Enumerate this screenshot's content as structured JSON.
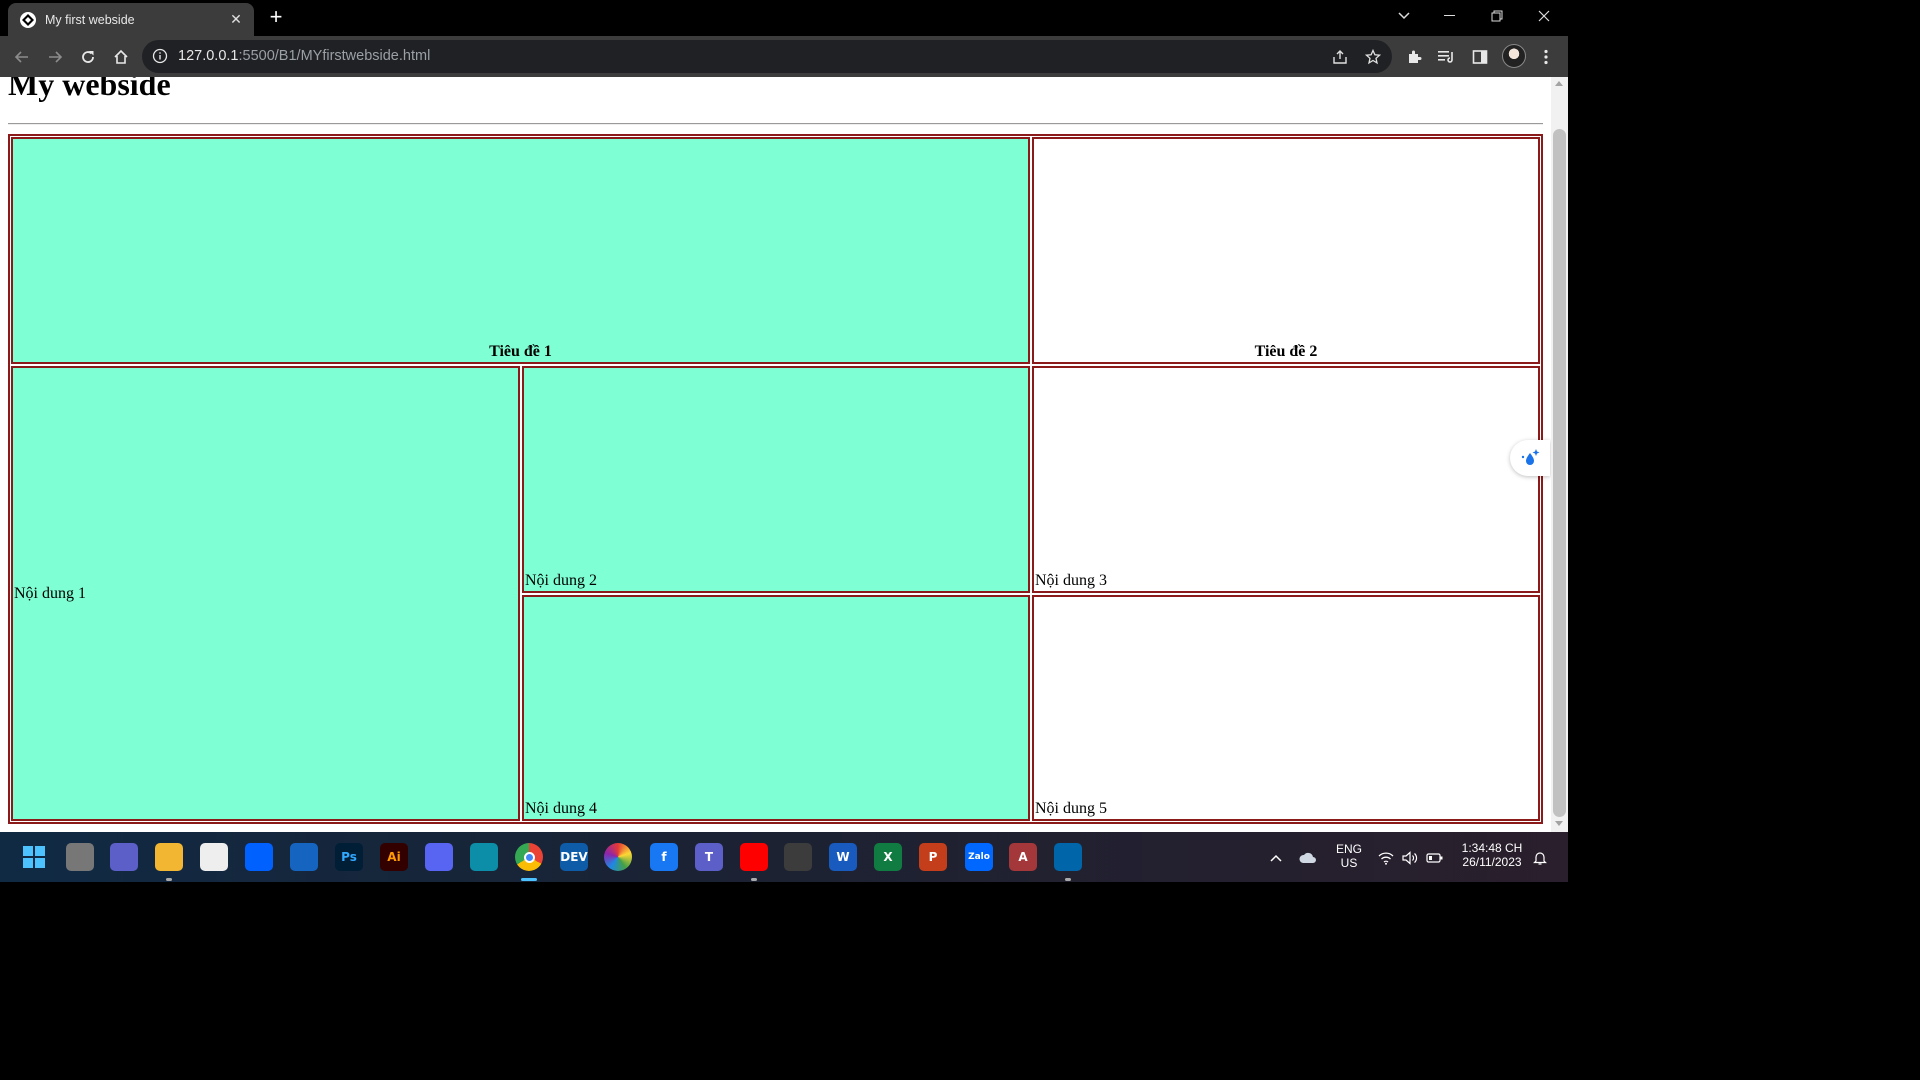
{
  "browser": {
    "tab_title": "My first webside",
    "tab_close": "✕",
    "new_tab": "+",
    "url_host": "127.0.0.1",
    "url_path": ":5500/B1/MYfirstwebside.html"
  },
  "page": {
    "heading": "My webside",
    "table": {
      "header1": "Tiêu đề 1",
      "header2": "Tiêu đề 2",
      "content1": "Nội dung 1",
      "content2": "Nội dung 2",
      "content3": "Nội dung 3",
      "content4": "Nội dung 4",
      "content5": "Nội dung 5"
    },
    "colors": {
      "aqua": "#7fffd4",
      "border": "#8b1a1a"
    }
  },
  "taskbar": {
    "apps": [
      {
        "name": "start",
        "icon": "windows-icon"
      },
      {
        "name": "task-view",
        "icon": "task-view-icon"
      },
      {
        "name": "meet",
        "icon": "video-icon"
      },
      {
        "name": "file-explorer",
        "icon": "folder-icon"
      },
      {
        "name": "store",
        "icon": "store-icon"
      },
      {
        "name": "dropbox",
        "icon": "dropbox-icon"
      },
      {
        "name": "defender",
        "icon": "shield-icon"
      },
      {
        "name": "photoshop",
        "icon": "ps-icon",
        "label": "Ps"
      },
      {
        "name": "illustrator",
        "icon": "ai-icon",
        "label": "Ai"
      },
      {
        "name": "discord",
        "icon": "discord-icon"
      },
      {
        "name": "edge",
        "icon": "edge-icon"
      },
      {
        "name": "chrome",
        "icon": "chrome-icon"
      },
      {
        "name": "devc",
        "icon": "devc-icon",
        "label": "DEV"
      },
      {
        "name": "color",
        "icon": "color-wheel-icon"
      },
      {
        "name": "facebook",
        "icon": "facebook-icon",
        "label": "f"
      },
      {
        "name": "teams",
        "icon": "teams-icon",
        "label": "T"
      },
      {
        "name": "youtube",
        "icon": "youtube-icon"
      },
      {
        "name": "git",
        "icon": "git-icon"
      },
      {
        "name": "word",
        "icon": "word-icon",
        "label": "W"
      },
      {
        "name": "excel",
        "icon": "excel-icon",
        "label": "X"
      },
      {
        "name": "powerpoint",
        "icon": "powerpoint-icon",
        "label": "P"
      },
      {
        "name": "zalo",
        "icon": "zalo-icon",
        "label": "Zalo"
      },
      {
        "name": "access",
        "icon": "access-icon",
        "label": "A"
      },
      {
        "name": "vscode",
        "icon": "vscode-icon"
      }
    ],
    "lang_line1": "ENG",
    "lang_line2": "US",
    "time": "1:34:48 CH",
    "date": "26/11/2023"
  }
}
